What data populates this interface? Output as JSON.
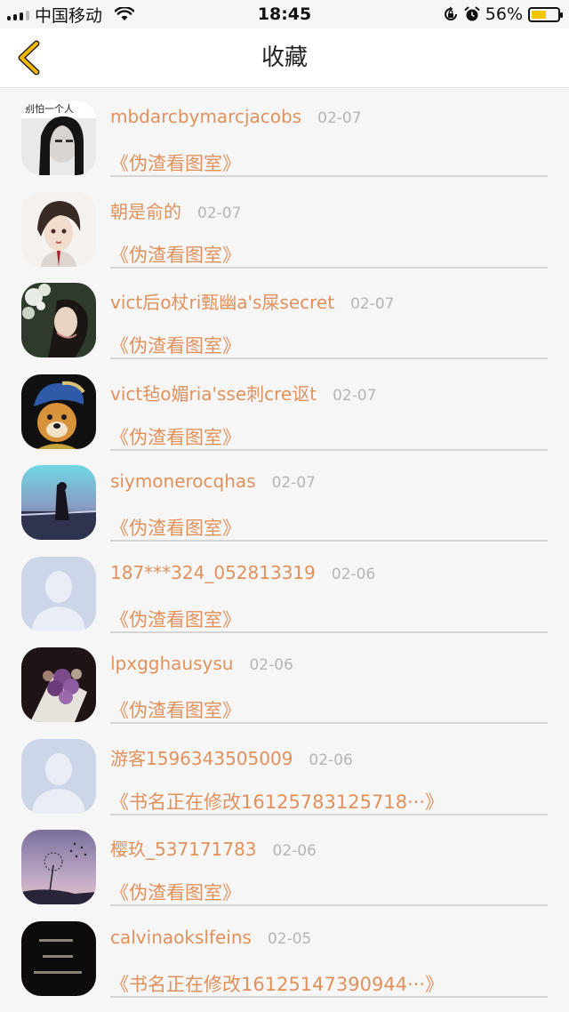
{
  "status_bar": {
    "carrier": "中国移动",
    "time": "18:45",
    "battery": "56%",
    "battery_level": 0.56
  },
  "nav": {
    "title": "收藏"
  },
  "favorites": [
    {
      "name": "mbdarcbymarcjacobs",
      "date": "02-07",
      "book": "《伪渣看图室》",
      "avatar_text": "别怕一个人"
    },
    {
      "name": "朝是俞的",
      "date": "02-07",
      "book": "《伪渣看图室》"
    },
    {
      "name": "vict后o杖ri甄幽a's屎secret",
      "date": "02-07",
      "book": "《伪渣看图室》"
    },
    {
      "name": "vict毡o媚ria'sse刺cre讴t",
      "date": "02-07",
      "book": "《伪渣看图室》"
    },
    {
      "name": "siymonerocqhas",
      "date": "02-07",
      "book": "《伪渣看图室》"
    },
    {
      "name": "187***324_052813319",
      "date": "02-06",
      "book": "《伪渣看图室》"
    },
    {
      "name": "lpxgghausysu",
      "date": "02-06",
      "book": "《伪渣看图室》"
    },
    {
      "name": "游客1596343505009",
      "date": "02-06",
      "book": "《书名正在修改16125783125718···》"
    },
    {
      "name": "樱玖_537171783",
      "date": "02-06",
      "book": "《伪渣看图室》"
    },
    {
      "name": "calvinaokslfeins",
      "date": "02-05",
      "book": "《书名正在修改16125147390944···》"
    }
  ],
  "colors": {
    "accent": "#e0915c",
    "date": "#b5b5b5",
    "back_chevron": "#f2b800",
    "background": "#f7f6f6"
  }
}
